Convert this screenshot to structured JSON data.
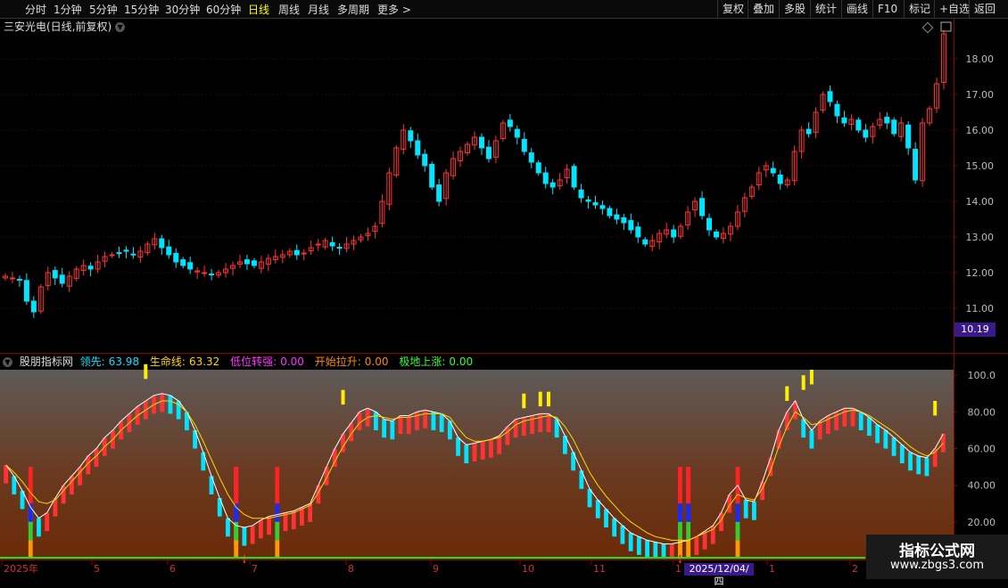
{
  "toolbar": {
    "timeframes": [
      "分时",
      "1分钟",
      "5分钟",
      "15分钟",
      "30分钟",
      "60分钟",
      "日线",
      "周线",
      "月线",
      "多周期",
      "更多 >"
    ],
    "active_timeframe": "日线",
    "right_buttons": [
      "复权",
      "叠加",
      "多股",
      "统计",
      "画线",
      "F10",
      "标记",
      "+自选",
      "返回"
    ]
  },
  "stock": {
    "title": "三安光电(日线,前复权)",
    "price_axis": [
      "18.00",
      "17.00",
      "16.00",
      "15.00",
      "14.00",
      "13.00",
      "12.00",
      "11.00"
    ],
    "last_price": "10.19"
  },
  "indicator": {
    "name": "股朋指标网",
    "lead_label": "领先:",
    "lead_value": "63.98",
    "life_label": "生命线:",
    "life_value": "63.32",
    "low_label": "低位转强:",
    "low_value": "0.00",
    "start_label": "开始拉升:",
    "start_value": "0.00",
    "bottom_label": "极地上涨:",
    "bottom_value": "0.00",
    "axis": [
      "100.0",
      "80.00",
      "60.00",
      "40.00",
      "20.00"
    ]
  },
  "time_axis": [
    "2025年",
    "5",
    "6",
    "7",
    "8",
    "9",
    "10",
    "11",
    "1",
    "2025/12/04/四",
    "1",
    "2"
  ],
  "watermark": {
    "line1": "指标公式网",
    "line2": "www.zbgs3.com"
  },
  "colors": {
    "up": "#ff3333",
    "down": "#00e5ff",
    "life": "#ffd700",
    "bg": "#000000"
  },
  "chart_data": [
    {
      "type": "candlestick",
      "title": "三安光电(日线,前复权)",
      "ylim": [
        10.2,
        18.7
      ],
      "close": [
        11.9,
        11.85,
        11.8,
        11.2,
        10.9,
        11.6,
        12.0,
        11.85,
        11.7,
        11.9,
        12.1,
        12.2,
        12.1,
        12.3,
        12.45,
        12.5,
        12.55,
        12.6,
        12.5,
        12.6,
        12.8,
        12.95,
        12.7,
        12.5,
        12.3,
        12.2,
        12.1,
        12.05,
        12.0,
        11.95,
        12.0,
        12.1,
        12.2,
        12.3,
        12.25,
        12.2,
        12.3,
        12.4,
        12.45,
        12.5,
        12.6,
        12.5,
        12.55,
        12.7,
        12.8,
        12.9,
        12.75,
        12.7,
        12.8,
        12.9,
        13.0,
        13.1,
        13.3,
        14.0,
        14.8,
        15.5,
        16.0,
        15.7,
        15.3,
        15.0,
        14.4,
        14.0,
        14.8,
        15.2,
        15.4,
        15.6,
        15.8,
        15.5,
        15.2,
        15.7,
        16.2,
        16.1,
        15.8,
        15.4,
        15.1,
        14.8,
        14.5,
        14.4,
        14.6,
        14.9,
        14.4,
        14.1,
        14.0,
        13.9,
        13.8,
        13.6,
        13.5,
        13.4,
        13.2,
        13.0,
        12.8,
        12.9,
        13.1,
        13.2,
        13.0,
        13.3,
        13.7,
        14.0,
        13.6,
        13.2,
        13.0,
        13.1,
        13.3,
        13.7,
        14.1,
        14.4,
        14.8,
        15.0,
        14.8,
        14.5,
        14.6,
        15.4,
        16.0,
        15.9,
        16.5,
        17.0,
        16.8,
        16.4,
        16.2,
        16.3,
        16.0,
        15.8,
        16.1,
        16.3,
        16.2,
        15.9,
        16.2,
        15.5,
        14.6,
        16.2,
        16.6,
        17.3,
        18.7
      ]
    },
    {
      "type": "bar",
      "title": "股朋指标网",
      "ylim": [
        0,
        103
      ],
      "lead": [
        51,
        45,
        37,
        28,
        22,
        25,
        33,
        40,
        45,
        50,
        56,
        60,
        66,
        70,
        75,
        79,
        83,
        86,
        89,
        90,
        89,
        86,
        80,
        70,
        58,
        45,
        33,
        22,
        18,
        17,
        18,
        21,
        23,
        24,
        25,
        26,
        28,
        30,
        40,
        50,
        60,
        68,
        74,
        80,
        82,
        80,
        76,
        75,
        78,
        78,
        80,
        81,
        80,
        79,
        75,
        66,
        62,
        63,
        64,
        65,
        67,
        72,
        76,
        77,
        78,
        79,
        79,
        76,
        67,
        58,
        48,
        38,
        32,
        27,
        22,
        18,
        14,
        12,
        10,
        9,
        8,
        8,
        9,
        10,
        12,
        15,
        18,
        25,
        35,
        40,
        32,
        31,
        42,
        55,
        70,
        80,
        86,
        76,
        70,
        75,
        78,
        80,
        82,
        82,
        80,
        77,
        73,
        70,
        66,
        62,
        58,
        56,
        55,
        60,
        68
      ],
      "life": [
        51,
        47,
        42,
        36,
        31,
        30,
        32,
        37,
        42,
        47,
        52,
        56,
        61,
        65,
        70,
        74,
        78,
        81,
        84,
        86,
        86,
        84,
        80,
        73,
        64,
        54,
        44,
        35,
        28,
        24,
        22,
        22,
        22,
        23,
        24,
        25,
        27,
        29,
        36,
        44,
        53,
        61,
        68,
        74,
        77,
        78,
        77,
        76,
        77,
        77,
        78,
        79,
        79,
        79,
        77,
        71,
        66,
        64,
        64,
        65,
        66,
        69,
        73,
        75,
        76,
        77,
        78,
        77,
        72,
        65,
        56,
        47,
        40,
        34,
        29,
        24,
        20,
        17,
        14,
        12,
        11,
        10,
        10,
        10,
        12,
        14,
        16,
        21,
        29,
        35,
        33,
        32,
        38,
        48,
        61,
        72,
        80,
        77,
        73,
        74,
        76,
        78,
        80,
        81,
        80,
        78,
        75,
        72,
        69,
        65,
        61,
        58,
        56,
        58,
        63
      ],
      "signal_markers": "yellow ticks and multi-color bars at turning points"
    }
  ]
}
